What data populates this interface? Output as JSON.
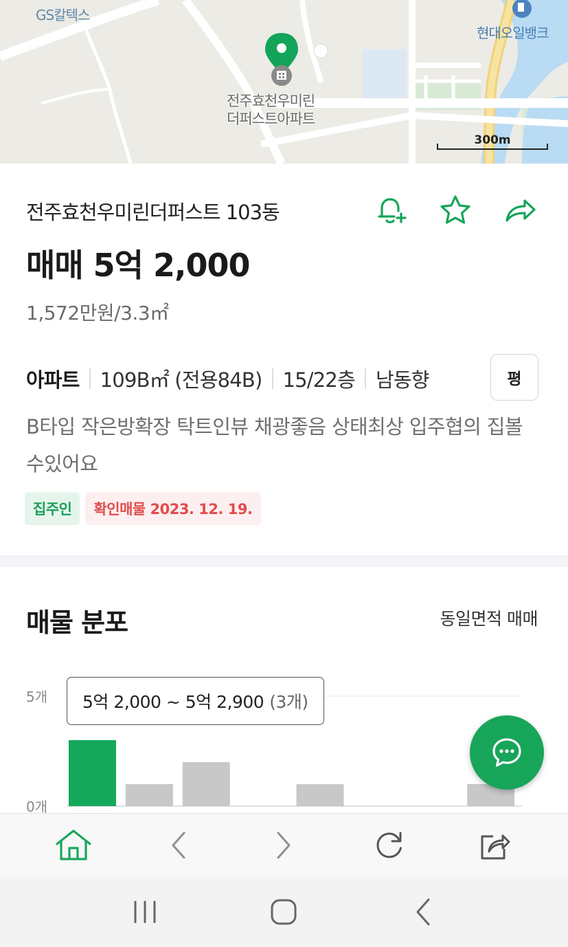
{
  "map": {
    "label_gs": "GS칼텍스",
    "label_hyundai": "현대오일뱅크",
    "marker_line1": "전주효천우미린",
    "marker_line2": "더퍼스트아파트",
    "scale": "300m"
  },
  "listing": {
    "title": "전주효천우미린더퍼스트 103동",
    "price": "매매 5억 2,000",
    "unit_price": "1,572만원/3.3㎡",
    "type": "아파트",
    "area": "109B㎡ (전용84B)",
    "floor": "15/22층",
    "direction": "남동향",
    "pyeong_label": "평",
    "description": "B타입 작은방확장 탁트인뷰 채광좋음 상태최상 입주협의 집볼수있어요",
    "tags": {
      "owner": "집주인",
      "verified": "확인매물 2023. 12. 19."
    },
    "icons": [
      "bell-plus-icon",
      "star-icon",
      "share-arrow-icon"
    ]
  },
  "distribution": {
    "title": "매물 분포",
    "filter": "동일면적 매매",
    "tooltip_range": "5억 2,000 ~ 5억 2,900",
    "tooltip_count": "(3개)",
    "accent_color": "#14a85a",
    "bar_color": "#c8c8c8"
  },
  "chart_data": {
    "type": "bar",
    "values": [
      3,
      1,
      2,
      0,
      1,
      0,
      0,
      1
    ],
    "highlighted_index": 0,
    "ylim": [
      0,
      5
    ],
    "ytick_labels": [
      "5개",
      "0개"
    ],
    "grid": true
  },
  "browser_bar": {
    "icons": [
      "home-icon",
      "back-icon",
      "forward-icon",
      "refresh-icon",
      "share-icon"
    ]
  },
  "system_nav": {
    "icons": [
      "recent-apps-icon",
      "home-circle-icon",
      "system-back-icon"
    ]
  }
}
